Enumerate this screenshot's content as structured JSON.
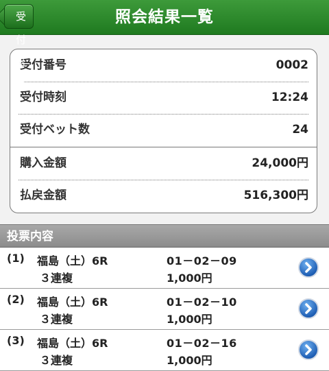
{
  "header": {
    "back_label": "受付番号",
    "title": "照会結果一覧",
    "accent_color": "#2a8a2a"
  },
  "summary": {
    "rows": [
      {
        "label": "受付番号",
        "value": "0002"
      },
      {
        "label": "受付時刻",
        "value": "12:24"
      },
      {
        "label": "受付ベット数",
        "value": "24"
      },
      {
        "label": "購入金額",
        "value": "24,000円"
      },
      {
        "label": "払戻金額",
        "value": "516,300円"
      }
    ]
  },
  "section": {
    "title": "投票内容"
  },
  "bets": [
    {
      "index": "(1)",
      "race": "福島（土）6R",
      "type": "３連複",
      "combo": "01－02－09",
      "amount": "1,000円",
      "icon": "chevron-right-icon"
    },
    {
      "index": "(2)",
      "race": "福島（土）6R",
      "type": "３連複",
      "combo": "01－02－10",
      "amount": "1,000円",
      "icon": "chevron-right-icon"
    },
    {
      "index": "(3)",
      "race": "福島（土）6R",
      "type": "３連複",
      "combo": "01－02－16",
      "amount": "1,000円",
      "icon": "chevron-right-icon"
    }
  ]
}
